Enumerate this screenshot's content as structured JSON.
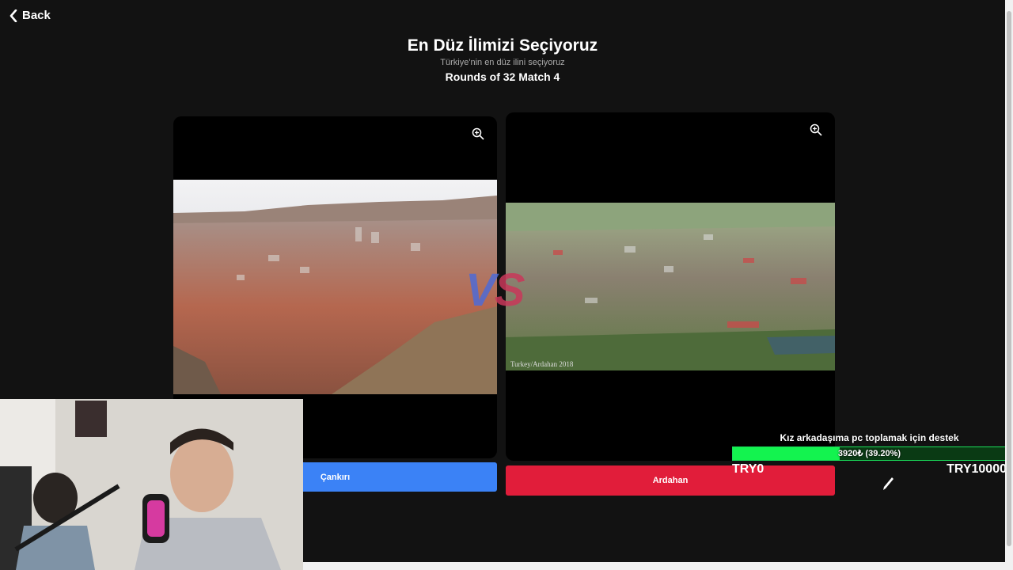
{
  "nav": {
    "back_label": "Back"
  },
  "header": {
    "title": "En Düz İlimizi Seçiyoruz",
    "subtitle": "Türkiye'nin en düz ilini seçiyoruz",
    "round": "Rounds of 32 Match 4"
  },
  "versus": {
    "v": "V",
    "s": "S"
  },
  "left_card": {
    "button_label": "Çankırı",
    "accent": "#3b82f6",
    "icon": "zoom-in-icon"
  },
  "right_card": {
    "button_label": "Ardahan",
    "caption": "Turkey/Ardahan 2018",
    "accent": "#e11d3a",
    "icon": "zoom-in-icon"
  },
  "donation": {
    "title": "Kız arkadaşıma pc toplamak için destek",
    "progress_text": "3920₺ (39.20%)",
    "progress_fraction": 0.392,
    "min_label": "TRY0",
    "max_label": "TRY10000",
    "bar_color": "#13f34f"
  }
}
